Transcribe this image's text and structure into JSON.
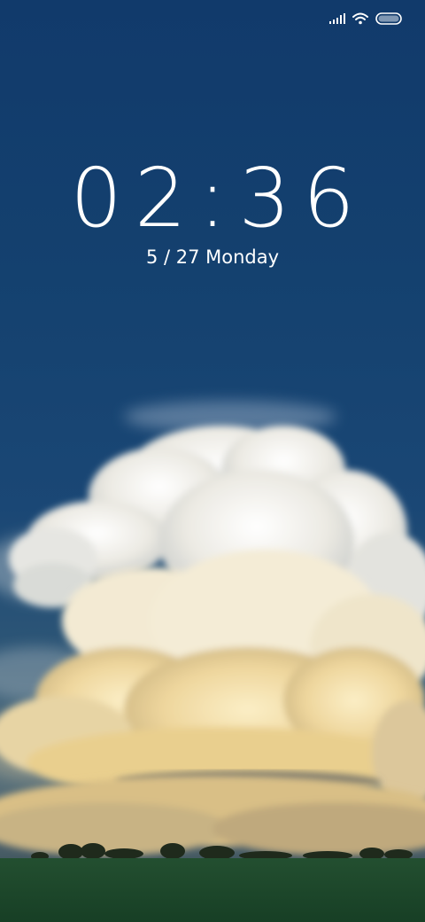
{
  "status_bar": {
    "signal_icon": "signal-bars-icon",
    "wifi_icon": "wifi-icon",
    "battery_icon": "battery-icon"
  },
  "lock_screen": {
    "time": "02:36",
    "date": "5 / 27 Monday"
  },
  "colors": {
    "sky": "#14416f",
    "cloud_light": "#f3f1ea",
    "cloud_warm": "#f0d9a2",
    "grass": "#1c4a2c",
    "text": "#ffffff"
  }
}
